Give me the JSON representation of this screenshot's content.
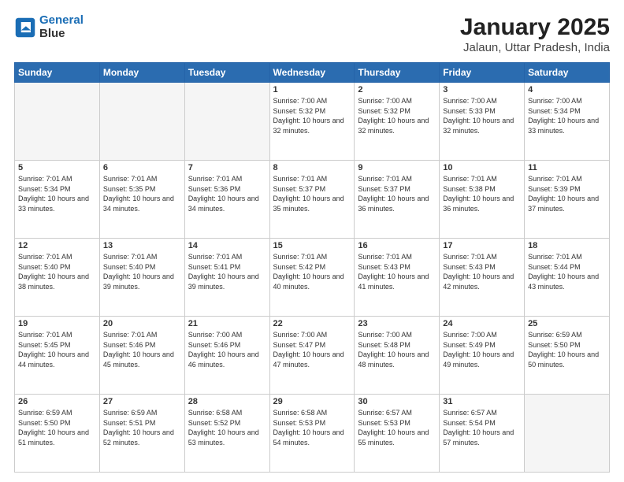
{
  "header": {
    "logo_line1": "General",
    "logo_line2": "Blue",
    "title": "January 2025",
    "subtitle": "Jalaun, Uttar Pradesh, India"
  },
  "weekdays": [
    "Sunday",
    "Monday",
    "Tuesday",
    "Wednesday",
    "Thursday",
    "Friday",
    "Saturday"
  ],
  "weeks": [
    [
      {
        "day": "",
        "sunrise": "",
        "sunset": "",
        "daylight": "",
        "empty": true
      },
      {
        "day": "",
        "sunrise": "",
        "sunset": "",
        "daylight": "",
        "empty": true
      },
      {
        "day": "",
        "sunrise": "",
        "sunset": "",
        "daylight": "",
        "empty": true
      },
      {
        "day": "1",
        "sunrise": "Sunrise: 7:00 AM",
        "sunset": "Sunset: 5:32 PM",
        "daylight": "Daylight: 10 hours and 32 minutes."
      },
      {
        "day": "2",
        "sunrise": "Sunrise: 7:00 AM",
        "sunset": "Sunset: 5:32 PM",
        "daylight": "Daylight: 10 hours and 32 minutes."
      },
      {
        "day": "3",
        "sunrise": "Sunrise: 7:00 AM",
        "sunset": "Sunset: 5:33 PM",
        "daylight": "Daylight: 10 hours and 32 minutes."
      },
      {
        "day": "4",
        "sunrise": "Sunrise: 7:00 AM",
        "sunset": "Sunset: 5:34 PM",
        "daylight": "Daylight: 10 hours and 33 minutes."
      }
    ],
    [
      {
        "day": "5",
        "sunrise": "Sunrise: 7:01 AM",
        "sunset": "Sunset: 5:34 PM",
        "daylight": "Daylight: 10 hours and 33 minutes."
      },
      {
        "day": "6",
        "sunrise": "Sunrise: 7:01 AM",
        "sunset": "Sunset: 5:35 PM",
        "daylight": "Daylight: 10 hours and 34 minutes."
      },
      {
        "day": "7",
        "sunrise": "Sunrise: 7:01 AM",
        "sunset": "Sunset: 5:36 PM",
        "daylight": "Daylight: 10 hours and 34 minutes."
      },
      {
        "day": "8",
        "sunrise": "Sunrise: 7:01 AM",
        "sunset": "Sunset: 5:37 PM",
        "daylight": "Daylight: 10 hours and 35 minutes."
      },
      {
        "day": "9",
        "sunrise": "Sunrise: 7:01 AM",
        "sunset": "Sunset: 5:37 PM",
        "daylight": "Daylight: 10 hours and 36 minutes."
      },
      {
        "day": "10",
        "sunrise": "Sunrise: 7:01 AM",
        "sunset": "Sunset: 5:38 PM",
        "daylight": "Daylight: 10 hours and 36 minutes."
      },
      {
        "day": "11",
        "sunrise": "Sunrise: 7:01 AM",
        "sunset": "Sunset: 5:39 PM",
        "daylight": "Daylight: 10 hours and 37 minutes."
      }
    ],
    [
      {
        "day": "12",
        "sunrise": "Sunrise: 7:01 AM",
        "sunset": "Sunset: 5:40 PM",
        "daylight": "Daylight: 10 hours and 38 minutes."
      },
      {
        "day": "13",
        "sunrise": "Sunrise: 7:01 AM",
        "sunset": "Sunset: 5:40 PM",
        "daylight": "Daylight: 10 hours and 39 minutes."
      },
      {
        "day": "14",
        "sunrise": "Sunrise: 7:01 AM",
        "sunset": "Sunset: 5:41 PM",
        "daylight": "Daylight: 10 hours and 39 minutes."
      },
      {
        "day": "15",
        "sunrise": "Sunrise: 7:01 AM",
        "sunset": "Sunset: 5:42 PM",
        "daylight": "Daylight: 10 hours and 40 minutes."
      },
      {
        "day": "16",
        "sunrise": "Sunrise: 7:01 AM",
        "sunset": "Sunset: 5:43 PM",
        "daylight": "Daylight: 10 hours and 41 minutes."
      },
      {
        "day": "17",
        "sunrise": "Sunrise: 7:01 AM",
        "sunset": "Sunset: 5:43 PM",
        "daylight": "Daylight: 10 hours and 42 minutes."
      },
      {
        "day": "18",
        "sunrise": "Sunrise: 7:01 AM",
        "sunset": "Sunset: 5:44 PM",
        "daylight": "Daylight: 10 hours and 43 minutes."
      }
    ],
    [
      {
        "day": "19",
        "sunrise": "Sunrise: 7:01 AM",
        "sunset": "Sunset: 5:45 PM",
        "daylight": "Daylight: 10 hours and 44 minutes."
      },
      {
        "day": "20",
        "sunrise": "Sunrise: 7:01 AM",
        "sunset": "Sunset: 5:46 PM",
        "daylight": "Daylight: 10 hours and 45 minutes."
      },
      {
        "day": "21",
        "sunrise": "Sunrise: 7:00 AM",
        "sunset": "Sunset: 5:46 PM",
        "daylight": "Daylight: 10 hours and 46 minutes."
      },
      {
        "day": "22",
        "sunrise": "Sunrise: 7:00 AM",
        "sunset": "Sunset: 5:47 PM",
        "daylight": "Daylight: 10 hours and 47 minutes."
      },
      {
        "day": "23",
        "sunrise": "Sunrise: 7:00 AM",
        "sunset": "Sunset: 5:48 PM",
        "daylight": "Daylight: 10 hours and 48 minutes."
      },
      {
        "day": "24",
        "sunrise": "Sunrise: 7:00 AM",
        "sunset": "Sunset: 5:49 PM",
        "daylight": "Daylight: 10 hours and 49 minutes."
      },
      {
        "day": "25",
        "sunrise": "Sunrise: 6:59 AM",
        "sunset": "Sunset: 5:50 PM",
        "daylight": "Daylight: 10 hours and 50 minutes."
      }
    ],
    [
      {
        "day": "26",
        "sunrise": "Sunrise: 6:59 AM",
        "sunset": "Sunset: 5:50 PM",
        "daylight": "Daylight: 10 hours and 51 minutes."
      },
      {
        "day": "27",
        "sunrise": "Sunrise: 6:59 AM",
        "sunset": "Sunset: 5:51 PM",
        "daylight": "Daylight: 10 hours and 52 minutes."
      },
      {
        "day": "28",
        "sunrise": "Sunrise: 6:58 AM",
        "sunset": "Sunset: 5:52 PM",
        "daylight": "Daylight: 10 hours and 53 minutes."
      },
      {
        "day": "29",
        "sunrise": "Sunrise: 6:58 AM",
        "sunset": "Sunset: 5:53 PM",
        "daylight": "Daylight: 10 hours and 54 minutes."
      },
      {
        "day": "30",
        "sunrise": "Sunrise: 6:57 AM",
        "sunset": "Sunset: 5:53 PM",
        "daylight": "Daylight: 10 hours and 55 minutes."
      },
      {
        "day": "31",
        "sunrise": "Sunrise: 6:57 AM",
        "sunset": "Sunset: 5:54 PM",
        "daylight": "Daylight: 10 hours and 57 minutes."
      },
      {
        "day": "",
        "sunrise": "",
        "sunset": "",
        "daylight": "",
        "empty": true
      }
    ]
  ]
}
